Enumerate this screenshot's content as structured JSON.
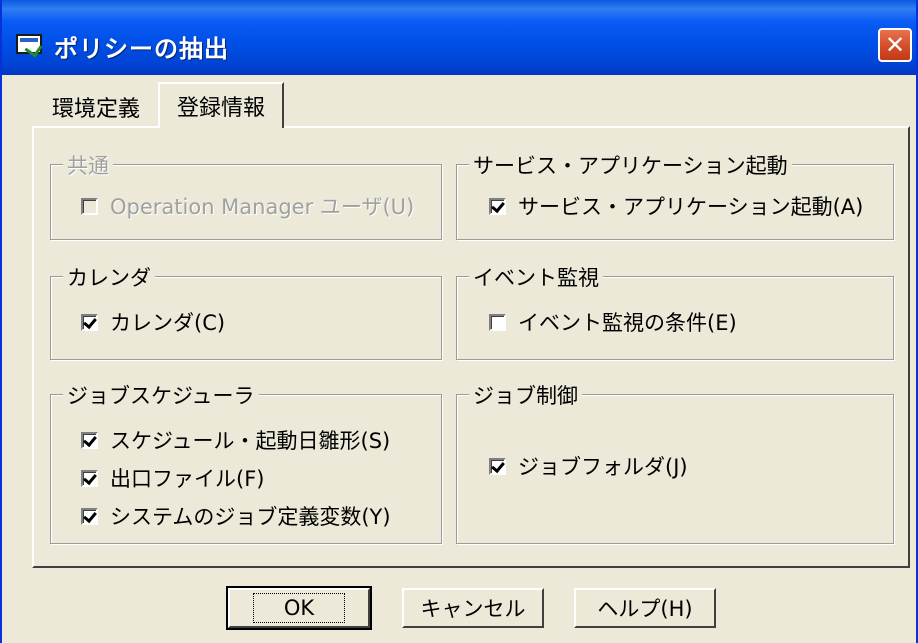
{
  "window": {
    "title": "ポリシーの抽出",
    "close_glyph": "✕"
  },
  "tabs": [
    {
      "label": "環境定義",
      "active": false
    },
    {
      "label": "登録情報",
      "active": true
    }
  ],
  "groups": {
    "common": {
      "title": "共通",
      "items": [
        {
          "label": "Operation Manager ユーザ(U)",
          "checked": false,
          "disabled": true
        }
      ]
    },
    "service": {
      "title": "サービス・アプリケーション起動",
      "items": [
        {
          "label": "サービス・アプリケーション起動(A)",
          "checked": true
        }
      ]
    },
    "calendar": {
      "title": "カレンダ",
      "items": [
        {
          "label": "カレンダ(C)",
          "checked": true
        }
      ]
    },
    "event": {
      "title": "イベント監視",
      "items": [
        {
          "label": "イベント監視の条件(E)",
          "checked": false
        }
      ]
    },
    "scheduler": {
      "title": "ジョブスケジューラ",
      "items": [
        {
          "label": "スケジュール・起動日雛形(S)",
          "checked": true
        },
        {
          "label": "出口ファイル(F)",
          "checked": true
        },
        {
          "label": "システムのジョブ定義変数(Y)",
          "checked": true
        }
      ]
    },
    "jobcontrol": {
      "title": "ジョブ制御",
      "items": [
        {
          "label": "ジョブフォルダ(J)",
          "checked": true
        }
      ]
    }
  },
  "buttons": {
    "ok": "OK",
    "cancel": "キャンセル",
    "help": "ヘルプ(H)"
  }
}
